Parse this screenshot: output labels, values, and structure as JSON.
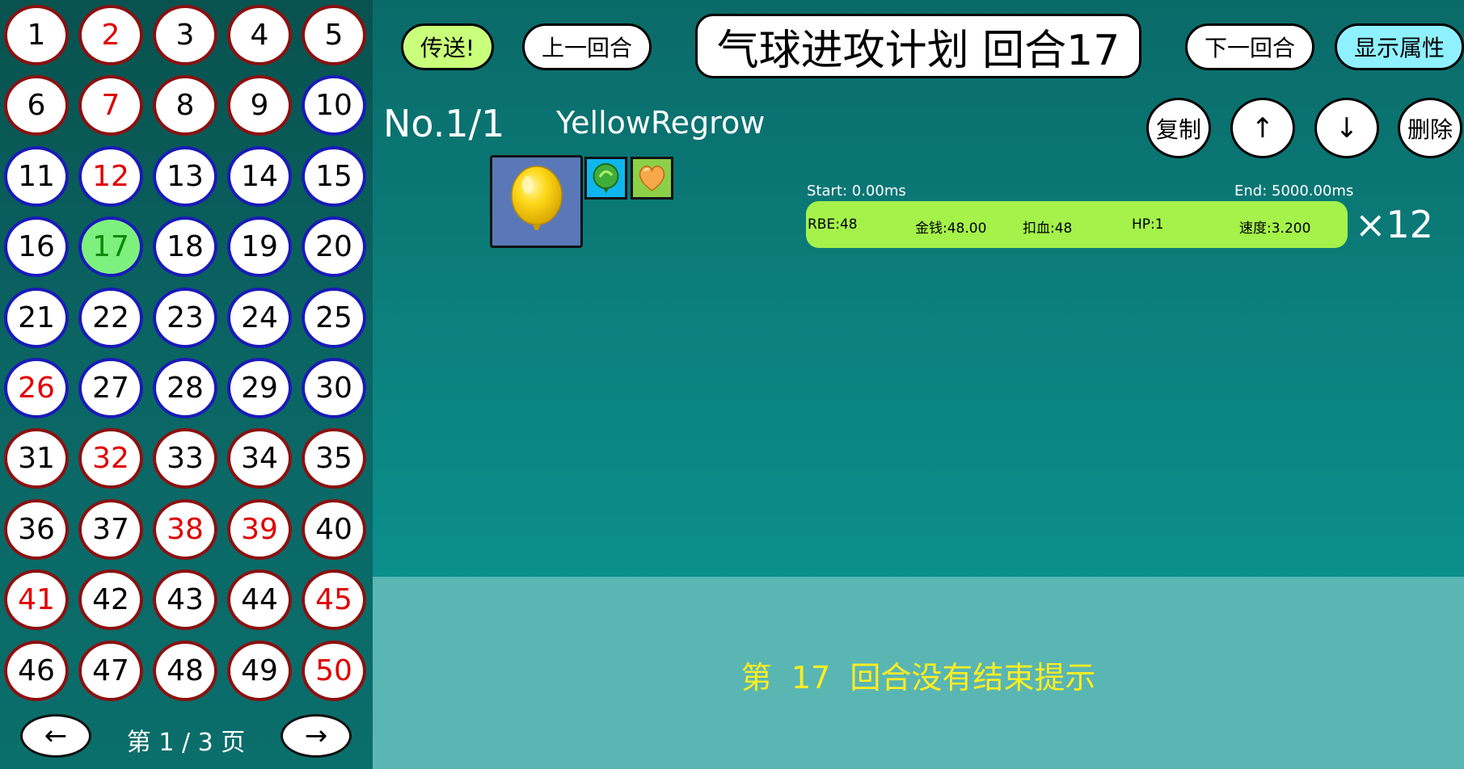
{
  "sidebar": {
    "rounds": [
      {
        "label": "1",
        "border": "red",
        "text": "black"
      },
      {
        "label": "2",
        "border": "red",
        "text": "red"
      },
      {
        "label": "3",
        "border": "red",
        "text": "black"
      },
      {
        "label": "4",
        "border": "red",
        "text": "black"
      },
      {
        "label": "5",
        "border": "red",
        "text": "black"
      },
      {
        "label": "6",
        "border": "red",
        "text": "black"
      },
      {
        "label": "7",
        "border": "red",
        "text": "red"
      },
      {
        "label": "8",
        "border": "red",
        "text": "black"
      },
      {
        "label": "9",
        "border": "red",
        "text": "black"
      },
      {
        "label": "10",
        "border": "blue",
        "text": "black"
      },
      {
        "label": "11",
        "border": "blue",
        "text": "black"
      },
      {
        "label": "12",
        "border": "blue",
        "text": "red"
      },
      {
        "label": "13",
        "border": "blue",
        "text": "black"
      },
      {
        "label": "14",
        "border": "blue",
        "text": "black"
      },
      {
        "label": "15",
        "border": "blue",
        "text": "black"
      },
      {
        "label": "16",
        "border": "blue",
        "text": "black"
      },
      {
        "label": "17",
        "border": "blue",
        "text": "green",
        "active": true
      },
      {
        "label": "18",
        "border": "blue",
        "text": "black"
      },
      {
        "label": "19",
        "border": "blue",
        "text": "black"
      },
      {
        "label": "20",
        "border": "blue",
        "text": "black"
      },
      {
        "label": "21",
        "border": "blue",
        "text": "black"
      },
      {
        "label": "22",
        "border": "blue",
        "text": "black"
      },
      {
        "label": "23",
        "border": "blue",
        "text": "black"
      },
      {
        "label": "24",
        "border": "blue",
        "text": "black"
      },
      {
        "label": "25",
        "border": "blue",
        "text": "black"
      },
      {
        "label": "26",
        "border": "blue",
        "text": "red"
      },
      {
        "label": "27",
        "border": "blue",
        "text": "black"
      },
      {
        "label": "28",
        "border": "blue",
        "text": "black"
      },
      {
        "label": "29",
        "border": "blue",
        "text": "black"
      },
      {
        "label": "30",
        "border": "blue",
        "text": "black"
      },
      {
        "label": "31",
        "border": "red",
        "text": "black"
      },
      {
        "label": "32",
        "border": "red",
        "text": "red"
      },
      {
        "label": "33",
        "border": "red",
        "text": "black"
      },
      {
        "label": "34",
        "border": "red",
        "text": "black"
      },
      {
        "label": "35",
        "border": "red",
        "text": "black"
      },
      {
        "label": "36",
        "border": "red",
        "text": "black"
      },
      {
        "label": "37",
        "border": "red",
        "text": "black"
      },
      {
        "label": "38",
        "border": "red",
        "text": "red"
      },
      {
        "label": "39",
        "border": "red",
        "text": "red"
      },
      {
        "label": "40",
        "border": "red",
        "text": "black"
      },
      {
        "label": "41",
        "border": "red",
        "text": "red"
      },
      {
        "label": "42",
        "border": "red",
        "text": "black"
      },
      {
        "label": "43",
        "border": "red",
        "text": "black"
      },
      {
        "label": "44",
        "border": "red",
        "text": "black"
      },
      {
        "label": "45",
        "border": "red",
        "text": "red"
      },
      {
        "label": "46",
        "border": "red",
        "text": "black"
      },
      {
        "label": "47",
        "border": "red",
        "text": "black"
      },
      {
        "label": "48",
        "border": "red",
        "text": "black"
      },
      {
        "label": "49",
        "border": "red",
        "text": "black"
      },
      {
        "label": "50",
        "border": "red",
        "text": "red"
      }
    ],
    "pager": {
      "prev_label": "←",
      "next_label": "→",
      "page_label": "第 1 / 3 页"
    }
  },
  "header": {
    "teleport_label": "传送!",
    "prev_round_label": "上一回合",
    "title": "气球进攻计划 回合17",
    "next_round_label": "下一回合",
    "show_attrs_label": "显示属性"
  },
  "entry": {
    "index": "No.1/1",
    "name": "YellowRegrow",
    "actions": {
      "copy": "复制",
      "up": "↑",
      "down": "↓",
      "delete": "删除"
    },
    "icons": [
      "yellow-balloon-icon",
      "regrow-icon",
      "heart-icon"
    ],
    "timeline": {
      "start": "Start: 0.00ms",
      "end": "End: 5000.00ms",
      "stats": {
        "rbe": "RBE:48",
        "money": "金钱:48.00",
        "damage": "扣血:48",
        "hp": "HP:1",
        "speed": "速度:3.200"
      }
    },
    "multiplier": "×12"
  },
  "hint": {
    "text": "第  17  回合没有结束提示"
  },
  "colors": {
    "accent_green": "#a4f24a",
    "teleport_green": "#c9ff7a",
    "attrs_cyan": "#8ff1ff",
    "hint_yellow": "#ffee22",
    "active_round": "#7ef07e",
    "border_red": "#8b1010",
    "border_blue": "#1a1ab8"
  }
}
